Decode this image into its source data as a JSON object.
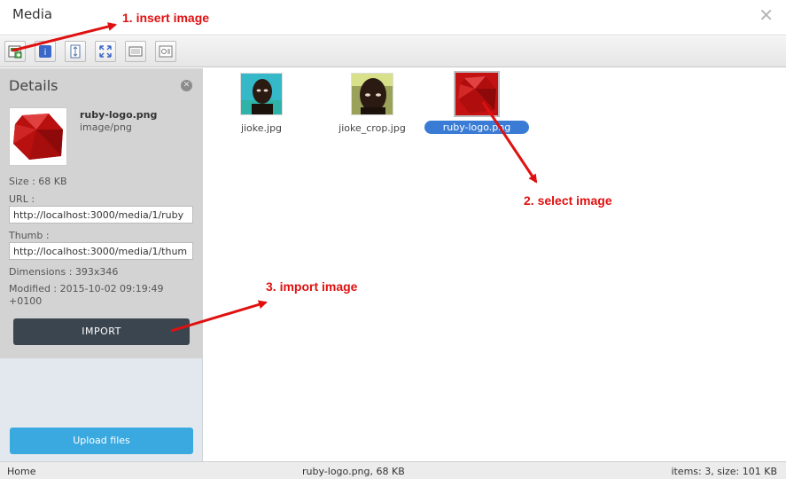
{
  "window": {
    "title": "Media"
  },
  "toolbar": {
    "buttons": [
      "insert-icon",
      "info-icon",
      "refresh-icon",
      "fullscreen-icon",
      "view-icon",
      "settings-icon"
    ]
  },
  "details": {
    "heading": "Details",
    "file_name": "ruby-logo.png",
    "file_type": "image/png",
    "size_label": "Size : 68 KB",
    "url_label": "URL :",
    "url_value": "http://localhost:3000/media/1/ruby",
    "thumb_label": "Thumb :",
    "thumb_value": "http://localhost:3000/media/1/thum",
    "dimensions_label": "Dimensions : 393x346",
    "modified_label": "Modified : 2015-10-02 09:19:49",
    "modified_tz": "+0100",
    "import_label": "IMPORT"
  },
  "upload": {
    "label": "Upload files"
  },
  "files": [
    {
      "name": "jioke.jpg",
      "selected": false
    },
    {
      "name": "jioke_crop.jpg",
      "selected": false
    },
    {
      "name": "ruby-logo.png",
      "selected": true
    }
  ],
  "status": {
    "left": "Home",
    "center": "ruby-logo.png, 68 KB",
    "right": "items: 3, size: 101 KB"
  },
  "annotations": {
    "step1": "1. insert image",
    "step2": "2. select image",
    "step3": "3. import image"
  },
  "colors": {
    "accent": "#3a7bd5",
    "import_button": "#3b4550",
    "upload_button": "#3aa9e0",
    "annotation": "#e01010"
  }
}
